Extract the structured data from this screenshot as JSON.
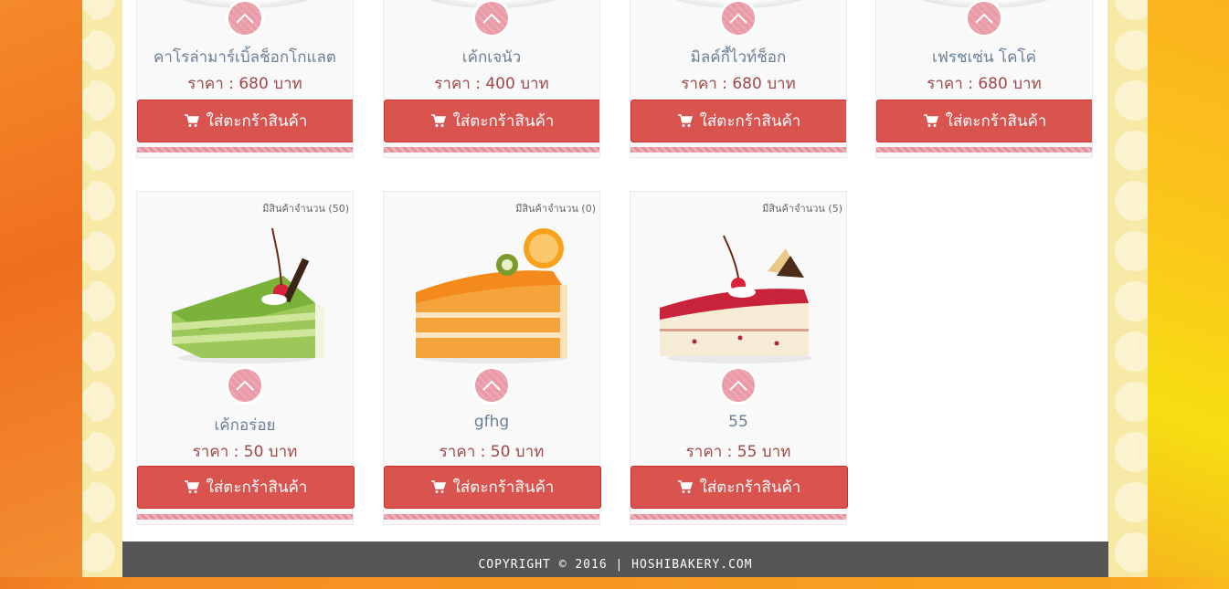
{
  "cart_button_label": "ใส่ตะกร้าสินค้า",
  "row1": [
    {
      "name": "คาโรล่ามาร์เบิ้ลช็อกโกแลต",
      "price": "ราคา : 680 บาท"
    },
    {
      "name": "เค้กเจนัว",
      "price": "ราคา : 400 บาท"
    },
    {
      "name": "มิลค์กี้ไวท์ช็อก",
      "price": "ราคา : 680 บาท"
    },
    {
      "name": "เฟรชเซ่น โคโค่",
      "price": "ราคา : 680 บาท"
    }
  ],
  "row2": [
    {
      "stock": "มีสินค้าจำนวน (50)",
      "name": "เค้กอร่อย",
      "price": "ราคา : 50 บาท",
      "image": "pandan-cake"
    },
    {
      "stock": "มีสินค้าจำนวน (0)",
      "name": "gfhg",
      "price": "ราคา : 50 บาท",
      "image": "orange-cake"
    },
    {
      "stock": "มีสินค้าจำนวน (5)",
      "name": "55",
      "price": "ราคา : 55 บาท",
      "image": "strawberry-cake"
    }
  ],
  "footer": {
    "text": "COPYRIGHT © 2016 | HOSHIBAKERY.COM"
  },
  "colors": {
    "button": "#d9534f",
    "price": "#a04848",
    "name": "#6a7f95",
    "footer": "#555555"
  }
}
